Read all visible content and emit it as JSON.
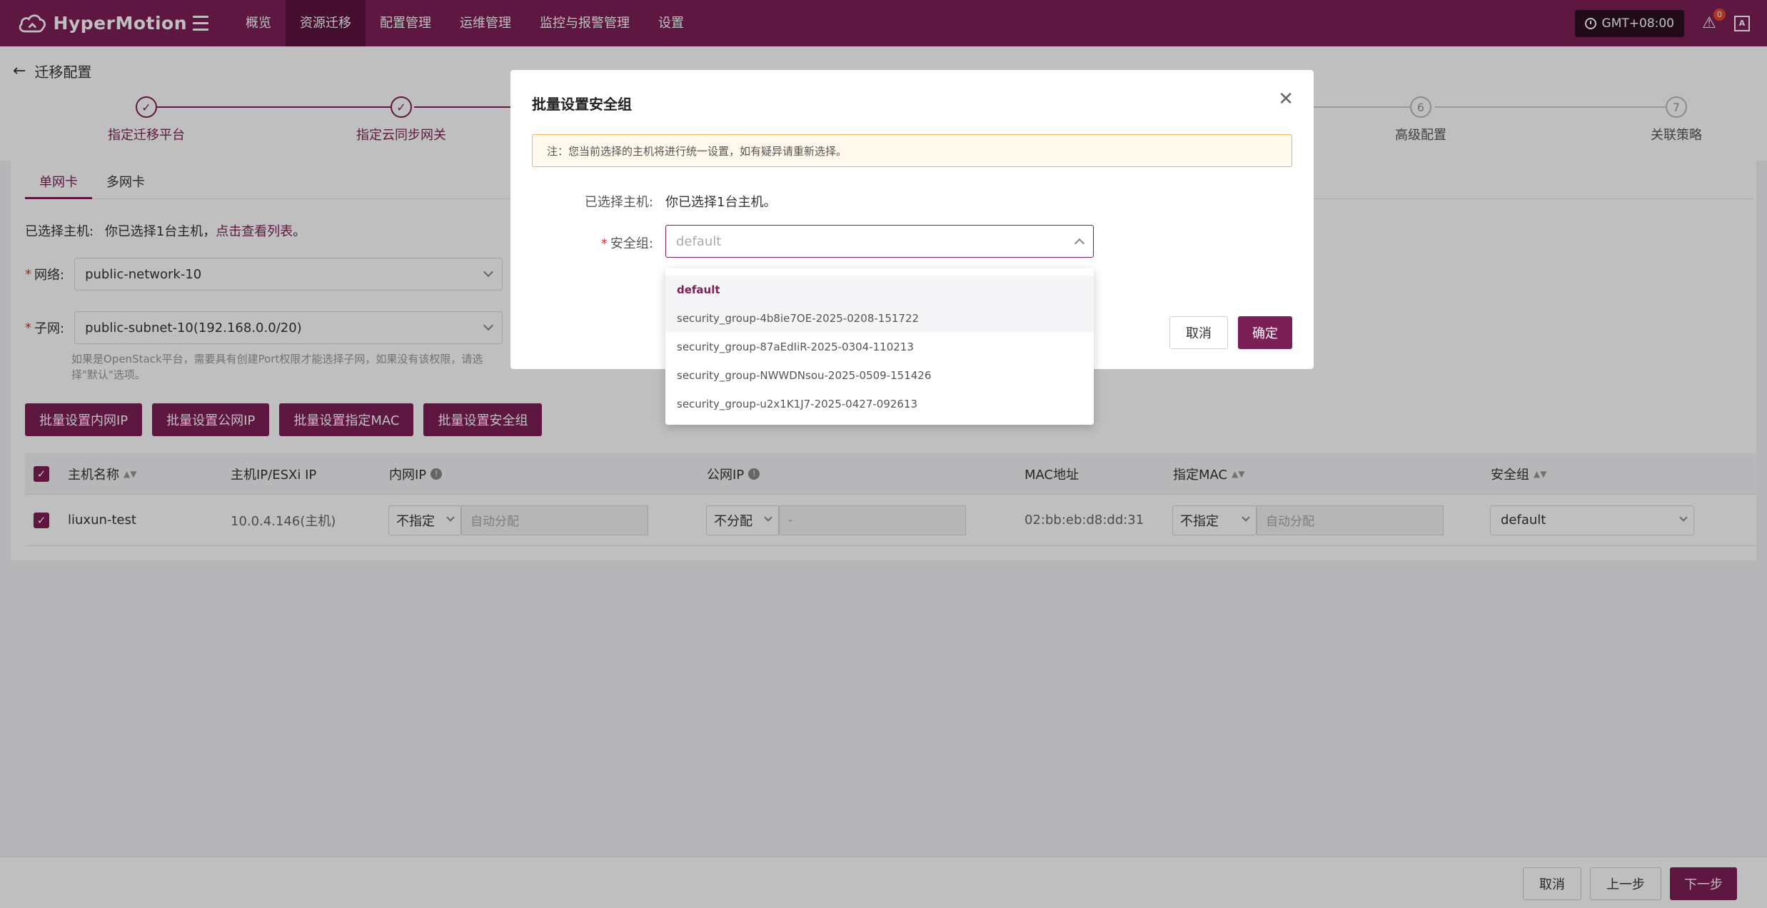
{
  "brand": {
    "name": "HyperMotion"
  },
  "nav": {
    "items": [
      {
        "label": "概览",
        "active": false
      },
      {
        "label": "资源迁移",
        "active": true
      },
      {
        "label": "配置管理",
        "active": false
      },
      {
        "label": "运维管理",
        "active": false
      },
      {
        "label": "监控与报警管理",
        "active": false
      },
      {
        "label": "设置",
        "active": false
      }
    ],
    "timezone": "GMT+08:00",
    "alert_count": "0",
    "lang_icon": "A"
  },
  "page": {
    "back_title": "迁移配置",
    "steps": [
      {
        "num": "✓",
        "label": "指定迁移平台",
        "done": true
      },
      {
        "num": "✓",
        "label": "指定云同步网关",
        "done": true
      },
      {
        "num": "6",
        "label": "高级配置",
        "done": false
      },
      {
        "num": "7",
        "label": "关联策略",
        "done": false
      }
    ]
  },
  "card": {
    "tabs": [
      "单网卡",
      "多网卡"
    ],
    "selected_hosts_label": "已选择主机:",
    "selected_hosts_text": "你已选择1台主机，",
    "selected_hosts_link": "点击查看列表",
    "selected_hosts_end": "。",
    "network_label": "网络:",
    "network_value": "public-network-10",
    "subnet_label": "子网:",
    "subnet_value": "public-subnet-10(192.168.0.0/20)",
    "hint": "如果是OpenStack平台，需要具有创建Port权限才能选择子网，如果没有该权限，请选择\"默认\"选项。",
    "batch_buttons": [
      "批量设置内网IP",
      "批量设置公网IP",
      "批量设置指定MAC",
      "批量设置安全组"
    ]
  },
  "table": {
    "headers": {
      "host_name": "主机名称",
      "host_ip": "主机IP/ESXi IP",
      "private_ip": "内网IP",
      "public_ip": "公网IP",
      "mac": "MAC地址",
      "assigned_mac": "指定MAC",
      "security_group": "安全组"
    },
    "row": {
      "host_name": "liuxun-test",
      "host_ip": "10.0.4.146(主机)",
      "private_ip_mode": "不指定",
      "private_ip_placeholder": "自动分配",
      "public_ip_mode": "不分配",
      "public_ip_placeholder": "-",
      "mac": "02:bb:eb:d8:dd:31",
      "assigned_mac_mode": "不指定",
      "assigned_mac_placeholder": "自动分配",
      "security_group": "default"
    }
  },
  "footer": {
    "cancel": "取消",
    "prev": "上一步",
    "next": "下一步"
  },
  "modal": {
    "title": "批量设置安全组",
    "notice": "注：您当前选择的主机将进行统一设置，如有疑异请重新选择。",
    "selected_label": "已选择主机:",
    "selected_value": "你已选择1台主机。",
    "sg_label": "安全组:",
    "sg_placeholder": "default",
    "cancel": "取消",
    "confirm": "确定"
  },
  "dropdown": {
    "options": [
      "default",
      "security_group-4b8ie7OE-2025-0208-151722",
      "security_group-87aEdIiR-2025-0304-110213",
      "security_group-NWWDNsou-2025-0509-151426",
      "security_group-u2x1K1J7-2025-0427-092613"
    ]
  },
  "colors": {
    "brand": "#7c1f56",
    "nav_active": "#5e1440",
    "warning_border": "#f1b466"
  }
}
